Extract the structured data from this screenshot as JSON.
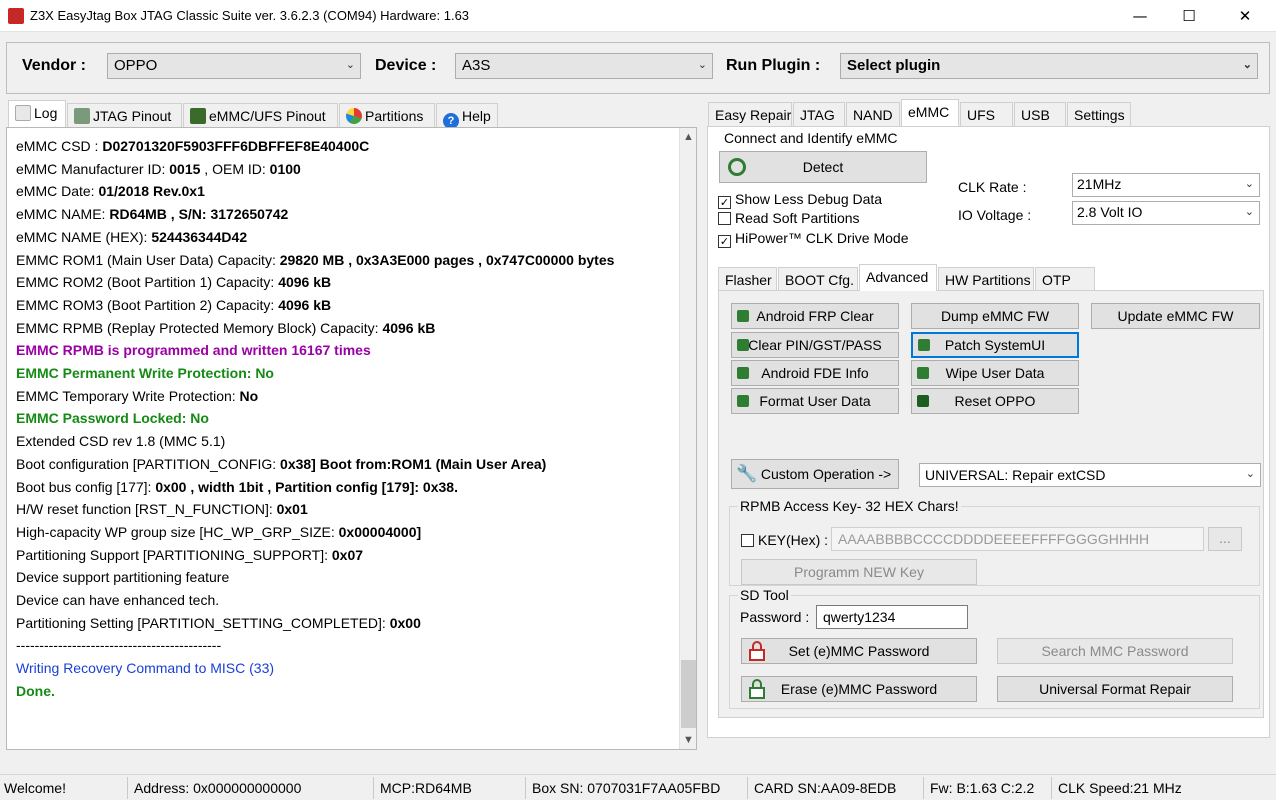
{
  "window": {
    "title": "Z3X EasyJtag Box JTAG Classic Suite ver. 3.6.2.3 (COM94) Hardware: 1.63",
    "minimize": "—",
    "maximize": "☐",
    "close": "✕"
  },
  "topbar": {
    "vendor_label": "Vendor :",
    "vendor_value": "OPPO",
    "device_label": "Device :",
    "device_value": "A3S",
    "plugin_label": "Run Plugin :",
    "plugin_value": "Select plugin"
  },
  "left_tabs": [
    "Log",
    "JTAG Pinout",
    "eMMC/UFS Pinout",
    "Partitions",
    "Help"
  ],
  "log": {
    "lines": [
      {
        "pre": "eMMC CSD : ",
        "bold": "D02701320F5903FFF6DBFFEF8E40400C",
        "post": ""
      },
      {
        "pre": "eMMC Manufacturer ID: ",
        "bold": "0015",
        "post": " , OEM ID: ",
        "bold2": "0100"
      },
      {
        "pre": "eMMC Date: ",
        "bold": "01/2018  Rev.0x1",
        "post": ""
      },
      {
        "pre": "eMMC NAME: ",
        "bold": "RD64MB , S/N: 3172650742",
        "post": ""
      },
      {
        "pre": "eMMC NAME (HEX): ",
        "bold": "524436344D42",
        "post": ""
      },
      {
        "pre": "EMMC ROM1 (Main User Data)   Capacity: ",
        "bold": "29820 MB , 0x3A3E000 pages , 0x747C00000 bytes",
        "post": ""
      },
      {
        "pre": "EMMC ROM2 (Boot Partition 1) Capacity: ",
        "bold": "4096 kB",
        "post": ""
      },
      {
        "pre": "EMMC ROM3 (Boot Partition 2) Capacity: ",
        "bold": "4096 kB",
        "post": ""
      },
      {
        "pre": "EMMC RPMB (Replay Protected Memory Block) Capacity: ",
        "bold": "4096 kB",
        "post": ""
      },
      {
        "purple": "EMMC RPMB is programmed and written 16167 times"
      },
      {
        "green": "EMMC Permanent Write Protection: No"
      },
      {
        "pre": "EMMC Temporary Write Protection: ",
        "bold": "No",
        "post": ""
      },
      {
        "green": "EMMC Password Locked: No"
      },
      {
        "pre": "  Extended CSD rev 1.8 (MMC 5.1)",
        "bold": "",
        "post": ""
      },
      {
        "pre": "Boot configuration [PARTITION_CONFIG: ",
        "bold": "0x38] Boot from:ROM1 (Main User Area)",
        "post": ""
      },
      {
        "pre": "Boot bus config [177]: ",
        "bold": "0x00 , width 1bit  , Partition config [179]: 0x38.",
        "post": ""
      },
      {
        "pre": "H/W reset function [RST_N_FUNCTION]: ",
        "bold": "0x01",
        "post": ""
      },
      {
        "pre": "High-capacity WP group size [HC_WP_GRP_SIZE: ",
        "bold": "0x00004000]",
        "post": ""
      },
      {
        "pre": "Partitioning Support [PARTITIONING_SUPPORT]: ",
        "bold": "0x07",
        "post": ""
      },
      {
        "pre": " Device support partitioning feature",
        "bold": "",
        "post": ""
      },
      {
        "pre": " Device can have enhanced tech.",
        "bold": "",
        "post": ""
      },
      {
        "pre": "Partitioning Setting [PARTITION_SETTING_COMPLETED]: ",
        "bold": "0x00",
        "post": ""
      },
      {
        "pre": "--------------------------------------------",
        "bold": "",
        "post": ""
      },
      {
        "blue": "Writing Recovery Command to MISC (33)"
      },
      {
        "green": "Done."
      }
    ]
  },
  "right_tabs": [
    "Easy Repair",
    "JTAG",
    "NAND",
    "eMMC",
    "UFS",
    "USB",
    "Settings"
  ],
  "connect": {
    "title": "Connect and Identify eMMC",
    "detect": "Detect",
    "show_less_debug": "Show Less Debug Data",
    "read_soft_partitions": "Read Soft Partitions",
    "hipower": "HiPower™ CLK Drive Mode",
    "clk_label": "CLK Rate :",
    "clk_value": "21MHz",
    "io_label": "IO Voltage :",
    "io_value": "2.8 Volt IO"
  },
  "sub_tabs": [
    "Flasher",
    "BOOT Cfg.",
    "Advanced",
    "HW Partitions",
    "OTP"
  ],
  "advanced": {
    "android_frp_clear": "Android FRP Clear",
    "clear_pin": "Clear PIN/GST/PASS",
    "android_fde_info": "Android FDE Info",
    "format_user_data": "Format User Data",
    "dump_emmc_fw": "Dump eMMC FW",
    "patch_systemui": "Patch SystemUI",
    "wipe_user_data": "Wipe User Data",
    "reset_oppo": "Reset OPPO",
    "update_emmc_fw": "Update eMMC FW",
    "custom_operation": "Custom Operation ->",
    "custom_value": "UNIVERSAL: Repair extCSD"
  },
  "rpmb": {
    "title": "RPMB Access Key- 32 HEX Chars!",
    "key_label": "KEY(Hex) :",
    "key_value": "AAAABBBBCCCCDDDDEEEEFFFFGGGGHHHH",
    "browse": "...",
    "program": "Programm NEW Key"
  },
  "sdtool": {
    "title": "SD Tool",
    "password_label": "Password :",
    "password_value": "qwerty1234",
    "set_password": "Set (e)MMC Password",
    "search_password": "Search MMC Password",
    "erase_password": "Erase (e)MMC Password",
    "universal_format": "Universal Format Repair"
  },
  "status": {
    "welcome": "Welcome!",
    "address": "Address: 0x000000000000",
    "mcp": "MCP:RD64MB",
    "box_sn": "Box SN: 0707031F7AA05FBD",
    "card_sn": "CARD SN:AA09-8EDB",
    "fw": "Fw: B:1.63 C:2.2",
    "clk": "CLK Speed:21 MHz"
  },
  "colors": {
    "purple": "#9b00a6",
    "green": "#158a15",
    "blue": "#1a3fd6",
    "focus": "#0078d7"
  }
}
